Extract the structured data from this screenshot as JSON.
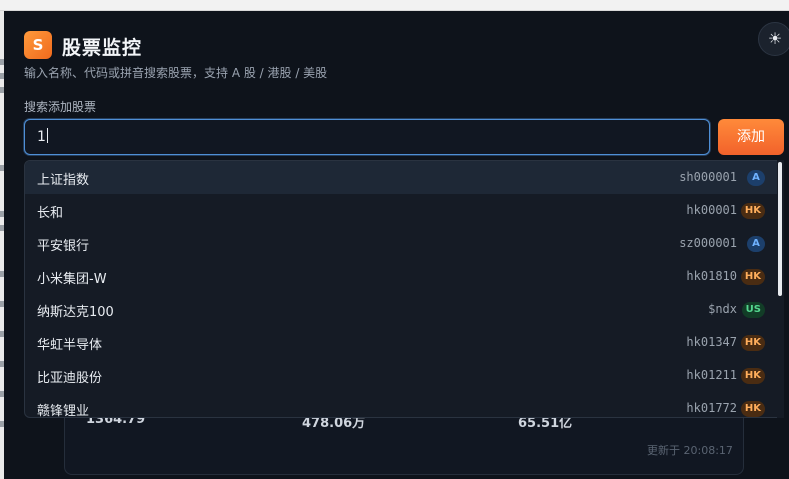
{
  "app": {
    "logo_letter": "S",
    "title": "股票监控",
    "subtitle": "输入名称、代码或拼音搜索股票，支持 A 股 / 港股 / 美股",
    "theme_icon": "☀"
  },
  "search": {
    "label": "搜索添加股票",
    "value": "1",
    "add_label": "添加"
  },
  "suggestions": [
    {
      "name": "上证指数",
      "code": "sh000001",
      "market": "A",
      "kind": "a"
    },
    {
      "name": "长和",
      "code": "hk00001",
      "market": "HK",
      "kind": "hk"
    },
    {
      "name": "平安银行",
      "code": "sz000001",
      "market": "A",
      "kind": "a"
    },
    {
      "name": "小米集团-W",
      "code": "hk01810",
      "market": "HK",
      "kind": "hk"
    },
    {
      "name": "纳斯达克100",
      "code": "$ndx",
      "market": "US",
      "kind": "us"
    },
    {
      "name": "华虹半导体",
      "code": "hk01347",
      "market": "HK",
      "kind": "hk"
    },
    {
      "name": "比亚迪股份",
      "code": "hk01211",
      "market": "HK",
      "kind": "hk"
    },
    {
      "name": "赣锋锂业",
      "code": "hk01772",
      "market": "HK",
      "kind": "hk"
    }
  ],
  "background_card": {
    "values": [
      "1364.79",
      "478.06万",
      "65.51亿"
    ],
    "updated": "更新于 20:08:17"
  },
  "colors": {
    "accent": "#f2622b",
    "panel_bg": "#0e131b",
    "badge_a": "#6fb2ff",
    "badge_hk": "#ffae5c",
    "badge_us": "#54d68f"
  }
}
